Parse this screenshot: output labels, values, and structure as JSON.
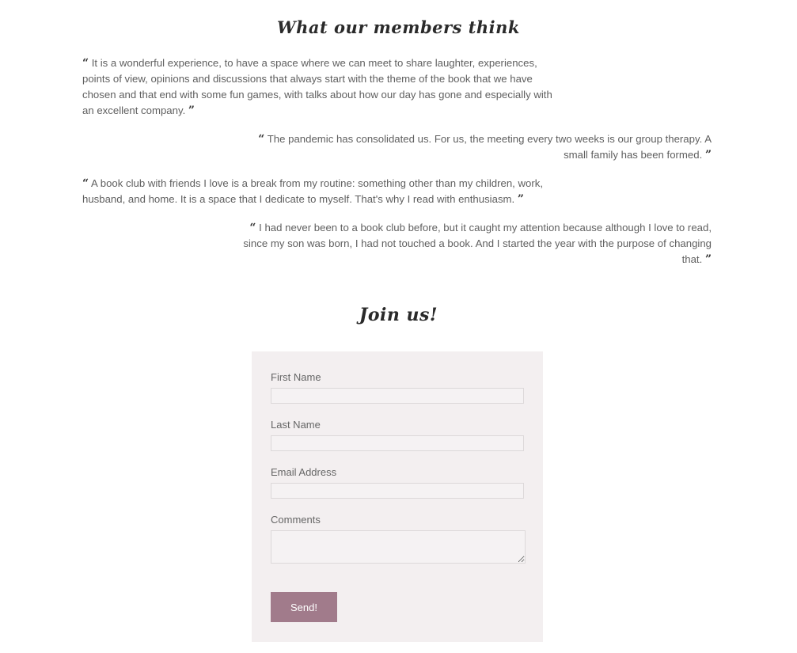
{
  "testimonials": {
    "title": "What our members think",
    "open_quote": "66",
    "close_quote": "99",
    "items": [
      {
        "text": "It is a wonderful experience, to have a space where we can meet to share laughter, experiences, points of view, opinions and discussions that always start with the theme of the book that we have chosen and that end with some fun games, with talks about how our day has gone and especially with an excellent company."
      },
      {
        "text": "The pandemic has consolidated us. For us, the meeting every two weeks is our group therapy. A small family has been formed."
      },
      {
        "text": "A book club with friends I love is a break from my routine: something other than my children, work, husband, and home. It is a space that I dedicate to myself. That's why I read with enthusiasm."
      },
      {
        "text": "I had never been to a book club before, but it caught my attention because although I love to read, since my son was born, I had not touched a book. And I started the year with the purpose of changing that."
      }
    ]
  },
  "join": {
    "title": "Join us!",
    "form": {
      "first_name_label": "First Name",
      "first_name_value": "",
      "last_name_label": "Last Name",
      "last_name_value": "",
      "email_label": "Email Address",
      "email_value": "",
      "comments_label": "Comments",
      "comments_value": "",
      "submit_label": "Send!"
    }
  },
  "colors": {
    "form_background": "#f3eff0",
    "button_background": "#a17b8b",
    "button_text": "#ffffff",
    "title_text": "#2a2a2a",
    "body_text": "#5f5f5f"
  },
  "icons": {
    "open_quote": "open-quote-icon",
    "close_quote": "close-quote-icon"
  }
}
